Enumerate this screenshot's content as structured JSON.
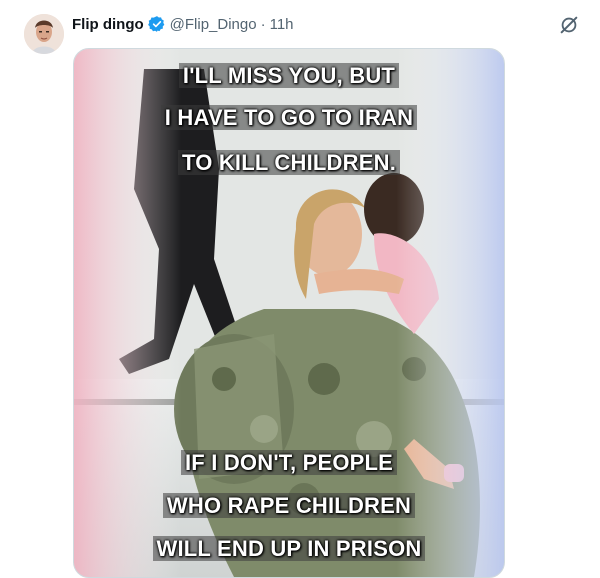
{
  "tweet": {
    "author_name": "Flip dingo",
    "handle": "@Flip_Dingo",
    "separator": "·",
    "time": "11h"
  },
  "icons": {
    "verified": "verified-badge-icon",
    "grok": "grok-icon"
  },
  "colors": {
    "verified_blue": "#1d9bf0",
    "text_primary": "#0f1419",
    "text_secondary": "#536471"
  },
  "meme": {
    "top_lines": [
      "I'LL MISS YOU, BUT",
      "I HAVE TO GO TO IRAN",
      "TO KILL CHILDREN."
    ],
    "bottom_lines": [
      "IF I DON'T, PEOPLE",
      "WHO RAPE CHILDREN",
      "WILL END UP IN PRISON"
    ]
  }
}
